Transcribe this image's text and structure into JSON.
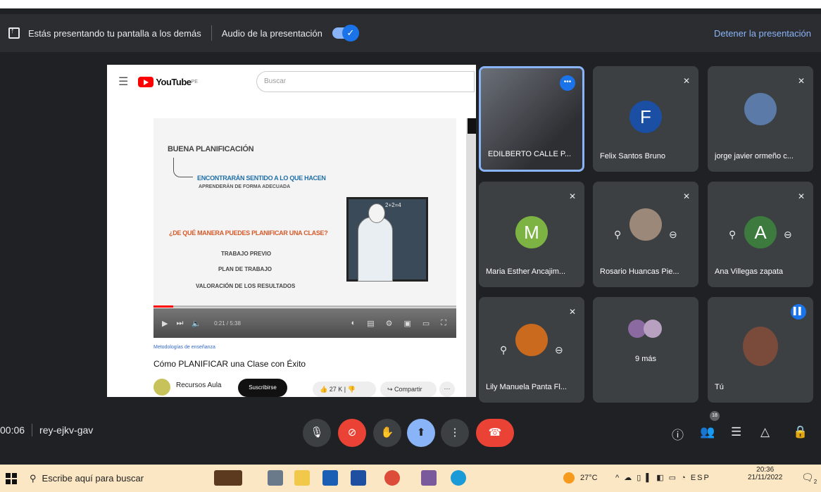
{
  "present_bar": {
    "message": "Estás presentando tu pantalla a los demás",
    "audio_label": "Audio de la presentación",
    "stop_label": "Detener la presentación"
  },
  "youtube": {
    "logo_text": "YouTube",
    "logo_sup": "PE",
    "search_placeholder": "Buscar",
    "category": "Metodologías de enseñanza",
    "video_title": "Cómo PLANIFICAR una Clase con Éxito",
    "channel": "Recursos Aula",
    "subscribe": "Suscribirse",
    "likes": "27 K",
    "share": "Compartir",
    "more": "···"
  },
  "slide": {
    "title": "BUENA PLANIFICACIÓN",
    "sub1": "ENCONTRARÁN SENTIDO A LO QUE HACEN",
    "sub2": "APRENDERÁN DE FORMA ADECUADA",
    "question": "¿DE QUÉ MANERA PUEDES PLANIFICAR UNA CLASE?",
    "items": [
      "TRABAJO PREVIO",
      "PLAN DE TRABAJO",
      "VALORACIÓN DE LOS RESULTADOS"
    ],
    "board_eq": "2+2=4",
    "time": "0:21 / 5:38"
  },
  "participants": [
    {
      "name": "EDILBERTO CALLE P..."
    },
    {
      "name": "Felix Santos Bruno",
      "initial": "F"
    },
    {
      "name": "jorge javier ormeño c..."
    },
    {
      "name": "Maria Esther Ancajim...",
      "initial": "M"
    },
    {
      "name": "Rosario Huancas Pie..."
    },
    {
      "name": "Ana Villegas zapata",
      "initial": "A"
    },
    {
      "name": "Lily Manuela Panta Fl..."
    },
    {
      "name": "9 más"
    },
    {
      "name": "Tú"
    }
  ],
  "bottom": {
    "time": "00:06",
    "meeting_code": "rey-ejkv-gav",
    "people_badge": "18"
  },
  "taskbar": {
    "search_placeholder": "Escribe aquí para buscar",
    "temperature": "27°C",
    "language": "ESP",
    "time": "20:36",
    "date": "21/11/2022",
    "notifications": "2"
  },
  "colors": {
    "meet_bg": "#202124",
    "tile_bg": "#3c4043",
    "accent": "#8ab4f8",
    "danger": "#ea4335",
    "taskbar": "#fbe7c4"
  }
}
